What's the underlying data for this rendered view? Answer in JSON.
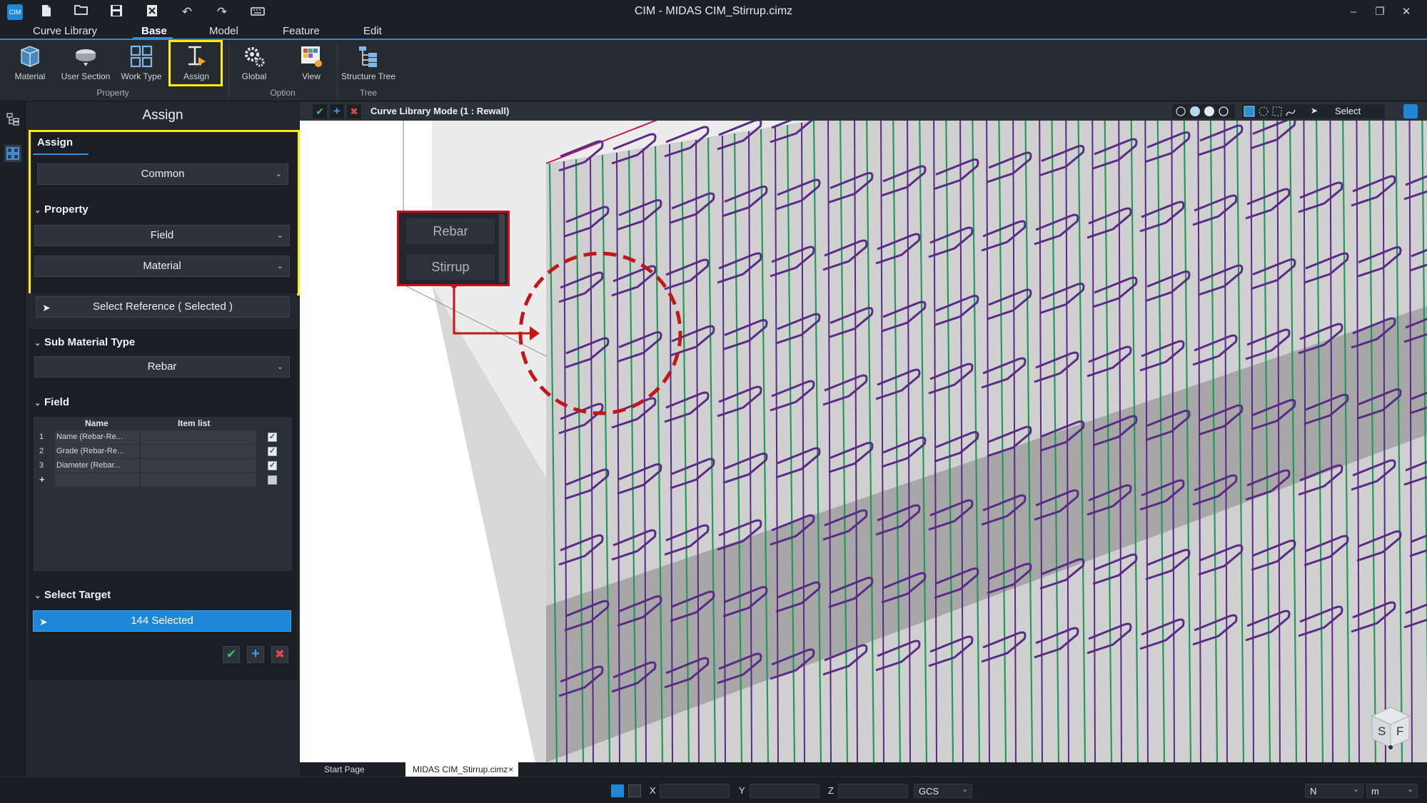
{
  "window": {
    "title": "CIM - MIDAS CIM_Stirrup.cimz",
    "app_badge": "CIM"
  },
  "menu": {
    "tabs": [
      {
        "label": "Curve Library"
      },
      {
        "label": "Base"
      },
      {
        "label": "Model"
      },
      {
        "label": "Feature"
      },
      {
        "label": "Edit"
      }
    ],
    "active": "Base"
  },
  "ribbon": {
    "buttons": [
      {
        "label": "Material",
        "icon": "material-icon"
      },
      {
        "label": "User Section",
        "icon": "user-section-icon"
      },
      {
        "label": "Work Type",
        "icon": "work-type-icon"
      },
      {
        "label": "Assign",
        "icon": "assign-icon"
      },
      {
        "label": "Global",
        "icon": "gear-icon"
      },
      {
        "label": "View",
        "icon": "view-icon"
      },
      {
        "label": "Structure Tree",
        "icon": "structure-tree-icon"
      }
    ],
    "groups": [
      {
        "label": "Property"
      },
      {
        "label": "Option"
      },
      {
        "label": "Tree"
      }
    ],
    "highlight_color": "#ffee00"
  },
  "panel": {
    "title": "Assign",
    "assign_tab": "Assign",
    "common_dropdown": "Common",
    "property_header": "Property",
    "field_dropdown": "Field",
    "material_dropdown": "Material",
    "select_reference": "Select Reference ( Selected )",
    "sub_material_header": "Sub Material Type",
    "sub_material_value": "Rebar",
    "field_header": "Field",
    "table": {
      "columns": [
        "Name",
        "Item list"
      ],
      "rows": [
        {
          "num": "1",
          "name": "Name    (Rebar-Re...",
          "checked": true
        },
        {
          "num": "2",
          "name": "Grade    (Rebar-Re...",
          "checked": true
        },
        {
          "num": "3",
          "name": "Diameter    (Rebar...",
          "checked": true
        },
        {
          "num": "+",
          "name": "",
          "checked": false
        }
      ]
    },
    "select_target_header": "Select Target",
    "selected_count": "144 Selected",
    "accent_color": "#1e88d6"
  },
  "viewport": {
    "mode_label": "Curve Library Mode (1 : Rewall)",
    "select_label": "Select",
    "callout": {
      "items": [
        "Rebar",
        "Stirrup"
      ],
      "border_color": "#cc1111"
    },
    "stirrup_color": "#5a2a86",
    "rebar_color": "#1f9a5a",
    "navcube": {
      "left_face": "S",
      "right_face": "F"
    }
  },
  "doc_tabs": [
    {
      "label": "Start Page"
    },
    {
      "label": "MIDAS CIM_Stirrup.cimz"
    }
  ],
  "status": {
    "x_label": "X",
    "y_label": "Y",
    "z_label": "Z",
    "coord_system": "GCS",
    "force_unit": "N",
    "length_unit": "m"
  }
}
